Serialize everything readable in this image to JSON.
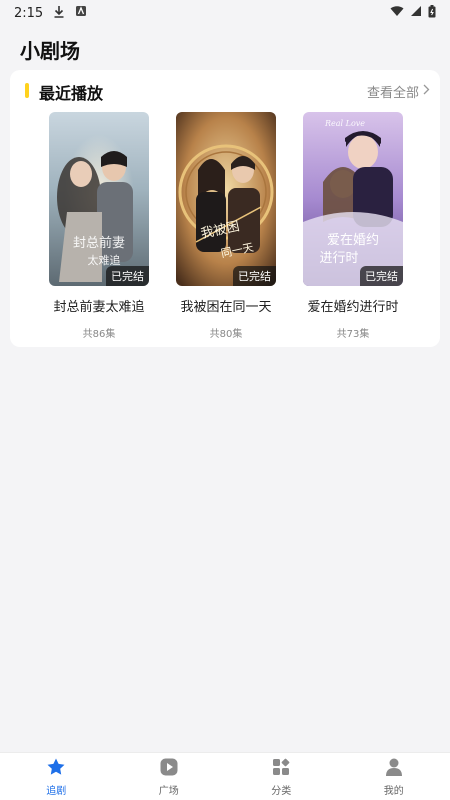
{
  "status": {
    "time": "2:15"
  },
  "page": {
    "title": "小剧场"
  },
  "recent": {
    "title": "最近播放",
    "see_all": "查看全部",
    "items": [
      {
        "title": "封总前妻太难追",
        "episodes": "共86集",
        "badge": "已完结",
        "poster_text": "封总前妻太难追"
      },
      {
        "title": "我被困在同一天",
        "episodes": "共80集",
        "badge": "已完结",
        "poster_text": "我被困在同一天"
      },
      {
        "title": "爱在婚约进行时",
        "episodes": "共73集",
        "badge": "已完结",
        "poster_text": "爱在婚约进行时"
      }
    ]
  },
  "tabs": [
    {
      "label": "追剧",
      "icon": "star-icon",
      "active": true
    },
    {
      "label": "广场",
      "icon": "play-icon",
      "active": false
    },
    {
      "label": "分类",
      "icon": "grid-icon",
      "active": false
    },
    {
      "label": "我的",
      "icon": "person-icon",
      "active": false
    }
  ],
  "colors": {
    "accent": "#ffd21e",
    "active_tab": "#1e6fe8"
  }
}
